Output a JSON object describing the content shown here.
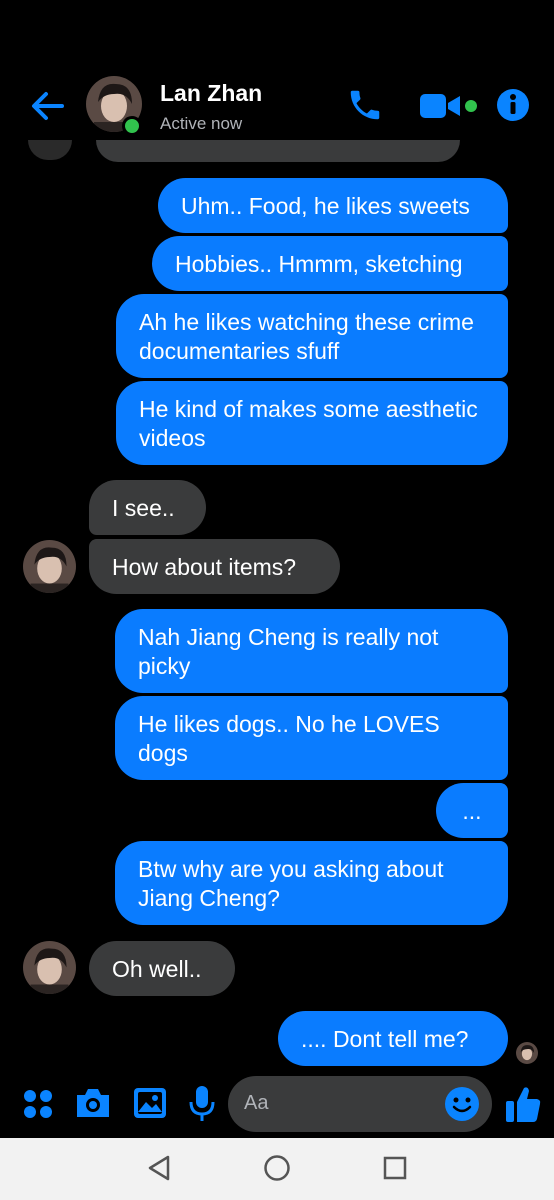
{
  "header": {
    "name": "Lan Zhan",
    "status": "Active now",
    "icons": [
      "back-arrow-icon",
      "phone-icon",
      "video-icon",
      "info-icon"
    ],
    "accent": "#0a84ff"
  },
  "messages": [
    {
      "dir": "out",
      "text": "Uhm.. Food, he likes sweets"
    },
    {
      "dir": "out",
      "text": "Hobbies.. Hmmm, sketching"
    },
    {
      "dir": "out",
      "text": "Ah he likes watching these crime documentaries sfuff"
    },
    {
      "dir": "out",
      "text": "He kind of makes some aesthetic videos"
    },
    {
      "dir": "in",
      "text": "I see.."
    },
    {
      "dir": "in",
      "text": "How about items?"
    },
    {
      "dir": "out",
      "text": "Nah Jiang Cheng is really not picky"
    },
    {
      "dir": "out",
      "text": "He likes dogs.. No he LOVES dogs"
    },
    {
      "dir": "out",
      "text": "..."
    },
    {
      "dir": "out",
      "text": "Btw why are you asking about Jiang Cheng?"
    },
    {
      "dir": "in",
      "text": "Oh well.."
    },
    {
      "dir": "out",
      "text": ".... Dont tell me?"
    }
  ],
  "composer": {
    "placeholder": "Aa",
    "icons": [
      "apps-icon",
      "camera-icon",
      "gallery-icon",
      "microphone-icon",
      "emoji-icon",
      "like-icon"
    ]
  },
  "colors": {
    "outgoing_bubble": "#0a7cff",
    "incoming_bubble": "#3a3b3c",
    "background": "#000000",
    "online": "#31c24d"
  }
}
